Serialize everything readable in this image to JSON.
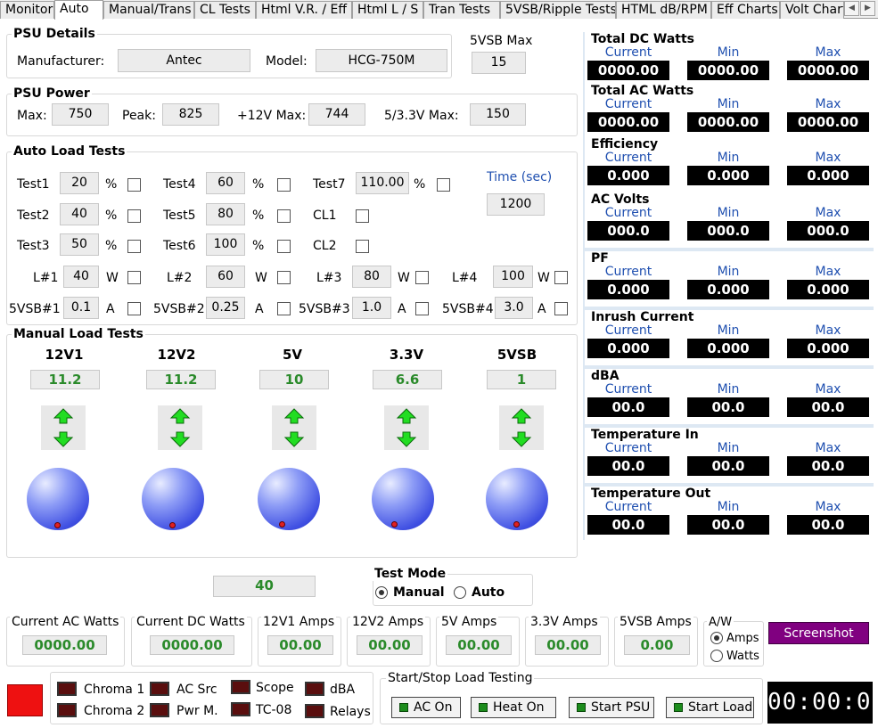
{
  "tabs": [
    "Monitor",
    "Auto",
    "Manual/Trans",
    "CL Tests",
    "Html V.R. / Eff",
    "Html L / S",
    "Tran Tests",
    "5VSB/Ripple Tests",
    "HTML dB/RPM",
    "Eff Charts",
    "Volt Chart"
  ],
  "tab_scroll": {
    "left": "◀",
    "right": "▶"
  },
  "psu_details": {
    "title": "PSU Details",
    "manufacturer_label": "Manufacturer:",
    "manufacturer": "Antec",
    "model_label": "Model:",
    "model": "HCG-750M"
  },
  "vsb_max": {
    "label": "5VSB Max",
    "value": "15"
  },
  "psu_power": {
    "title": "PSU Power",
    "max_label": "Max:",
    "max": "750",
    "peak_label": "Peak:",
    "peak": "825",
    "v12_label": "+12V Max:",
    "v12": "744",
    "v53_label": "5/3.3V Max:",
    "v53": "150"
  },
  "auto_load": {
    "title": "Auto Load Tests",
    "tests": [
      {
        "label": "Test1",
        "value": "20",
        "unit": "%"
      },
      {
        "label": "Test2",
        "value": "40",
        "unit": "%"
      },
      {
        "label": "Test3",
        "value": "50",
        "unit": "%"
      },
      {
        "label": "Test4",
        "value": "60",
        "unit": "%"
      },
      {
        "label": "Test5",
        "value": "80",
        "unit": "%"
      },
      {
        "label": "Test6",
        "value": "100",
        "unit": "%"
      },
      {
        "label": "Test7",
        "value": "110.00",
        "unit": "%"
      }
    ],
    "cl1": "CL1",
    "cl2": "CL2",
    "time_label": "Time (sec)",
    "time": "1200",
    "loads": [
      {
        "label": "L#1",
        "value": "40",
        "unit": "W"
      },
      {
        "label": "L#2",
        "value": "60",
        "unit": "W"
      },
      {
        "label": "L#3",
        "value": "80",
        "unit": "W"
      },
      {
        "label": "L#4",
        "value": "100",
        "unit": "W"
      }
    ],
    "vsb": [
      {
        "label": "5VSB#1",
        "value": "0.1",
        "unit": "A"
      },
      {
        "label": "5VSB#2",
        "value": "0.25",
        "unit": "A"
      },
      {
        "label": "5VSB#3",
        "value": "1.0",
        "unit": "A"
      },
      {
        "label": "5VSB#4",
        "value": "3.0",
        "unit": "A"
      }
    ]
  },
  "manual_load": {
    "title": "Manual Load Tests",
    "rails": [
      {
        "label": "12V1",
        "value": "11.2"
      },
      {
        "label": "12V2",
        "value": "11.2"
      },
      {
        "label": "5V",
        "value": "10"
      },
      {
        "label": "3.3V",
        "value": "6.6"
      },
      {
        "label": "5VSB",
        "value": "1"
      }
    ]
  },
  "bottom_value": "40",
  "test_mode": {
    "title": "Test Mode",
    "manual": "Manual",
    "auto": "Auto",
    "selected": "Manual"
  },
  "meters": [
    {
      "title": "Total DC Watts",
      "current": "0000.00",
      "min": "0000.00",
      "max": "0000.00"
    },
    {
      "title": "Total AC Watts",
      "current": "0000.00",
      "min": "0000.00",
      "max": "0000.00"
    },
    {
      "title": "Efficiency",
      "current": "0.000",
      "min": "0.000",
      "max": "0.000"
    },
    {
      "title": "AC Volts",
      "current": "000.0",
      "min": "000.0",
      "max": "000.0"
    },
    {
      "title": "PF",
      "current": "0.000",
      "min": "0.000",
      "max": "0.000"
    },
    {
      "title": "Inrush Current",
      "current": "0.000",
      "min": "0.000",
      "max": "0.000"
    },
    {
      "title": "dBA",
      "current": "00.0",
      "min": "00.0",
      "max": "00.0"
    },
    {
      "title": "Temperature In",
      "current": "00.0",
      "min": "00.0",
      "max": "00.0"
    },
    {
      "title": "Temperature Out",
      "current": "00.0",
      "min": "00.0",
      "max": "00.0"
    }
  ],
  "meter_headers": {
    "current": "Current",
    "min": "Min",
    "max": "Max"
  },
  "status": [
    {
      "title": "Current AC Watts",
      "value": "0000.00"
    },
    {
      "title": "Current DC Watts",
      "value": "0000.00"
    },
    {
      "title": "12V1 Amps",
      "value": "00.00"
    },
    {
      "title": "12V2 Amps",
      "value": "00.00"
    },
    {
      "title": "5V Amps",
      "value": "00.00"
    },
    {
      "title": "3.3V Amps",
      "value": "00.00"
    },
    {
      "title": "5VSB Amps",
      "value": "0.00"
    }
  ],
  "aw": {
    "title": "A/W",
    "amps": "Amps",
    "watts": "Watts",
    "selected": "Amps"
  },
  "screenshot_label": "Screenshot",
  "devices": [
    {
      "label": "Chroma 1"
    },
    {
      "label": "Chroma 2"
    },
    {
      "label": "AC Src"
    },
    {
      "label": "Pwr M."
    },
    {
      "label": "Scope"
    },
    {
      "label": "TC-08"
    },
    {
      "label": "dBA"
    },
    {
      "label": "Relays"
    }
  ],
  "start_stop": {
    "title": "Start/Stop Load Testing",
    "buttons": [
      "AC On",
      "Heat On",
      "Start PSU",
      "Start Load"
    ]
  },
  "clock": "00:00:00",
  "colors": {
    "status_red": "#ee1111",
    "accent_purple": "#800080",
    "value_green": "#2a8a2a",
    "header_blue": "#2050b0",
    "panel_bg": "#dde8f3"
  }
}
